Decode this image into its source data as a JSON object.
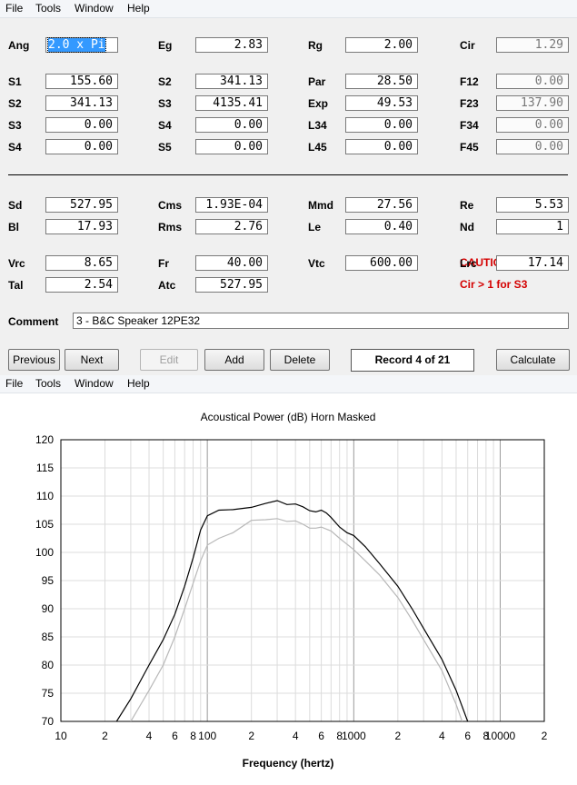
{
  "menu": {
    "file": "File",
    "tools": "Tools",
    "window": "Window",
    "help": "Help"
  },
  "form": {
    "fields": [
      {
        "id": "ang",
        "label": "Ang",
        "value": "2.0 x Pi",
        "selected": true
      },
      {
        "id": "eg",
        "label": "Eg",
        "value": "2.83"
      },
      {
        "id": "rg",
        "label": "Rg",
        "value": "2.00"
      },
      {
        "id": "cir",
        "label": "Cir",
        "value": "1.29",
        "readonly": true
      },
      {
        "id": "s1",
        "label": "S1",
        "value": "155.60"
      },
      {
        "id": "s2b",
        "label": "S2",
        "value": "341.13"
      },
      {
        "id": "par",
        "label": "Par",
        "value": "28.50"
      },
      {
        "id": "f12",
        "label": "F12",
        "value": "0.00",
        "readonly": true
      },
      {
        "id": "s2",
        "label": "S2",
        "value": "341.13"
      },
      {
        "id": "s3b",
        "label": "S3",
        "value": "4135.41"
      },
      {
        "id": "exp",
        "label": "Exp",
        "value": "49.53"
      },
      {
        "id": "f23",
        "label": "F23",
        "value": "137.90",
        "readonly": true
      },
      {
        "id": "s3",
        "label": "S3",
        "value": "0.00"
      },
      {
        "id": "s4b",
        "label": "S4",
        "value": "0.00"
      },
      {
        "id": "l34",
        "label": "L34",
        "value": "0.00"
      },
      {
        "id": "f34",
        "label": "F34",
        "value": "0.00",
        "readonly": true
      },
      {
        "id": "s4",
        "label": "S4",
        "value": "0.00"
      },
      {
        "id": "s5",
        "label": "S5",
        "value": "0.00"
      },
      {
        "id": "l45",
        "label": "L45",
        "value": "0.00"
      },
      {
        "id": "f45",
        "label": "F45",
        "value": "0.00",
        "readonly": true
      },
      {
        "id": "sd",
        "label": "Sd",
        "value": "527.95"
      },
      {
        "id": "cms",
        "label": "Cms",
        "value": "1.93E-04"
      },
      {
        "id": "mmd",
        "label": "Mmd",
        "value": "27.56"
      },
      {
        "id": "re",
        "label": "Re",
        "value": "5.53"
      },
      {
        "id": "bl",
        "label": "Bl",
        "value": "17.93"
      },
      {
        "id": "rms",
        "label": "Rms",
        "value": "2.76"
      },
      {
        "id": "le",
        "label": "Le",
        "value": "0.40"
      },
      {
        "id": "nd",
        "label": "Nd",
        "value": "1"
      },
      {
        "id": "vrc",
        "label": "Vrc",
        "value": "8.65"
      },
      {
        "id": "fr",
        "label": "Fr",
        "value": "40.00"
      },
      {
        "id": "vtc",
        "label": "Vtc",
        "value": "600.00"
      },
      {
        "id": "lrc",
        "label": "Lrc",
        "value": "17.14"
      },
      {
        "id": "tal",
        "label": "Tal",
        "value": "2.54"
      },
      {
        "id": "atc",
        "label": "Atc",
        "value": "527.95"
      }
    ],
    "caution_title": "CAUTION:",
    "caution_text": "Cir > 1 for S3",
    "comment_label": "Comment",
    "comment_value": "3 - B&C Speaker 12PE32"
  },
  "buttons": {
    "previous": "Previous",
    "next": "Next",
    "edit": "Edit",
    "add": "Add",
    "delete": "Delete",
    "record": "Record 4 of 21",
    "calculate": "Calculate"
  },
  "chart_data": {
    "type": "line",
    "title": "Acoustical Power (dB)   Horn   Masked",
    "xlabel": "Frequency (hertz)",
    "ylabel": "",
    "xscale": "log",
    "xlim": [
      10,
      20000
    ],
    "ylim": [
      70,
      120
    ],
    "yticks": [
      70,
      75,
      80,
      85,
      90,
      95,
      100,
      105,
      110,
      115,
      120
    ],
    "xtick_labels": [
      {
        "v": 10,
        "t": "10"
      },
      {
        "v": 20,
        "t": "2"
      },
      {
        "v": 40,
        "t": "4"
      },
      {
        "v": 60,
        "t": "6"
      },
      {
        "v": 80,
        "t": "8"
      },
      {
        "v": 100,
        "t": "100"
      },
      {
        "v": 200,
        "t": "2"
      },
      {
        "v": 400,
        "t": "4"
      },
      {
        "v": 600,
        "t": "6"
      },
      {
        "v": 800,
        "t": "8"
      },
      {
        "v": 1000,
        "t": "1000"
      },
      {
        "v": 2000,
        "t": "2"
      },
      {
        "v": 4000,
        "t": "4"
      },
      {
        "v": 6000,
        "t": "6"
      },
      {
        "v": 8000,
        "t": "8"
      },
      {
        "v": 10000,
        "t": "10000"
      },
      {
        "v": 20000,
        "t": "2"
      }
    ],
    "grid": true,
    "series": [
      {
        "color": "#000000",
        "points": [
          [
            24,
            70
          ],
          [
            30,
            74
          ],
          [
            40,
            80
          ],
          [
            50,
            84.5
          ],
          [
            60,
            89
          ],
          [
            70,
            94
          ],
          [
            80,
            99
          ],
          [
            90,
            104
          ],
          [
            100,
            106.5
          ],
          [
            120,
            107.5
          ],
          [
            150,
            107.6
          ],
          [
            200,
            108
          ],
          [
            250,
            108.7
          ],
          [
            300,
            109.2
          ],
          [
            350,
            108.5
          ],
          [
            400,
            108.6
          ],
          [
            450,
            108.1
          ],
          [
            500,
            107.4
          ],
          [
            550,
            107.2
          ],
          [
            600,
            107.5
          ],
          [
            650,
            107
          ],
          [
            700,
            106.2
          ],
          [
            800,
            104.5
          ],
          [
            900,
            103.5
          ],
          [
            1000,
            103
          ],
          [
            1200,
            101
          ],
          [
            1500,
            98
          ],
          [
            2000,
            94
          ],
          [
            2500,
            90
          ],
          [
            3000,
            86.5
          ],
          [
            4000,
            81
          ],
          [
            5000,
            75.5
          ],
          [
            6000,
            70
          ]
        ]
      },
      {
        "color": "#b8b8b8",
        "points": [
          [
            30,
            70
          ],
          [
            40,
            75.5
          ],
          [
            50,
            80
          ],
          [
            60,
            85
          ],
          [
            70,
            90
          ],
          [
            80,
            94.5
          ],
          [
            90,
            98.5
          ],
          [
            100,
            101.3
          ],
          [
            120,
            102.5
          ],
          [
            150,
            103.5
          ],
          [
            200,
            105.7
          ],
          [
            250,
            105.8
          ],
          [
            300,
            106
          ],
          [
            350,
            105.5
          ],
          [
            400,
            105.6
          ],
          [
            450,
            105
          ],
          [
            500,
            104.3
          ],
          [
            550,
            104.3
          ],
          [
            600,
            104.5
          ],
          [
            700,
            103.8
          ],
          [
            800,
            102.5
          ],
          [
            1000,
            100.5
          ],
          [
            1200,
            98.5
          ],
          [
            1500,
            96
          ],
          [
            2000,
            92
          ],
          [
            2500,
            88
          ],
          [
            3000,
            84.5
          ],
          [
            4000,
            79
          ],
          [
            5000,
            73
          ],
          [
            5500,
            70
          ]
        ]
      }
    ]
  }
}
